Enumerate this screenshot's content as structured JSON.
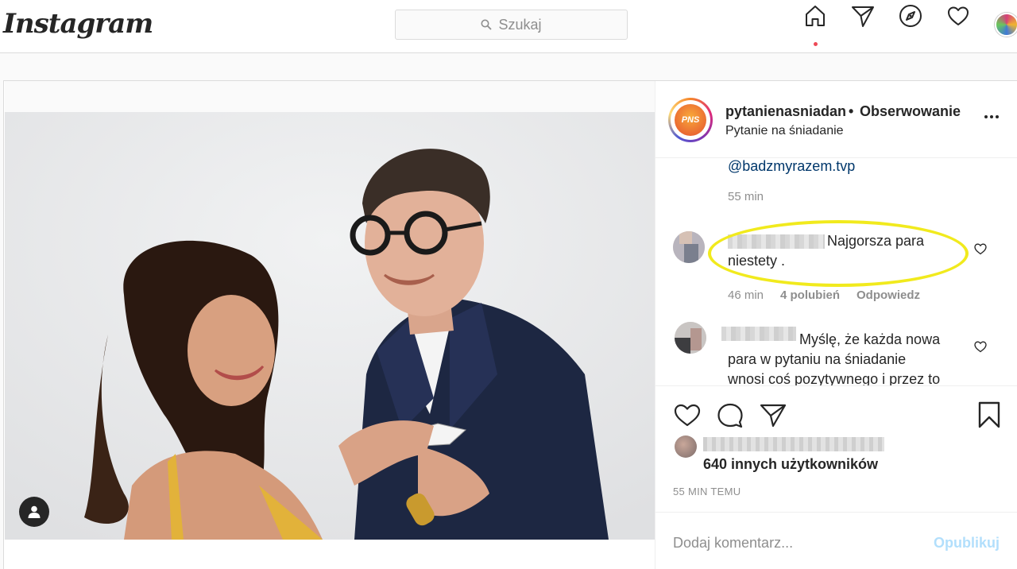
{
  "nav": {
    "logo": "Instagram",
    "search_placeholder": "Szukaj"
  },
  "post": {
    "username": "pytanienasniadan",
    "separator": "•",
    "follow_label": "Obserwowanie",
    "account_name": "Pytanie na śniadanie",
    "avatar_badge": "PNS",
    "mention": "@badzmyrazem.tvp",
    "mention_time": "55 min",
    "comments": [
      {
        "text_line1": "Najgorsza para",
        "text_line2": "niestety .",
        "time": "46 min",
        "likes": "4 polubień",
        "reply": "Odpowiedz"
      },
      {
        "text_line1": "Myślę, że każda nowa",
        "text_line2": "para w pytaniu na śniadanie",
        "text_line3": "wnosi coś pozytywnego i przez to"
      }
    ],
    "liked_by_others": "640 innych użytkowników",
    "timestamp": "55 MIN TEMU",
    "comment_placeholder": "Dodaj komentarz...",
    "publish_label": "Opublikuj"
  },
  "colors": {
    "highlight": "#f1ea1d",
    "link": "#00376b",
    "notification_dot": "#ed4956",
    "publish_disabled": "#b2dffc"
  }
}
